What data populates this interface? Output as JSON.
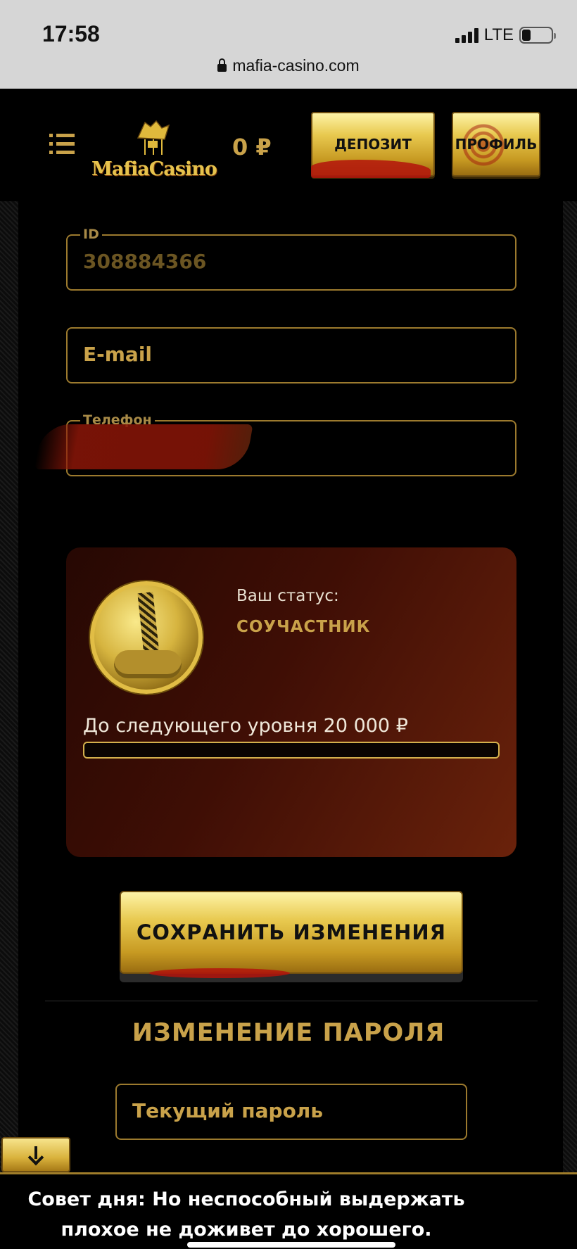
{
  "status_bar": {
    "time": "17:58",
    "network": "LTE",
    "url": "mafia-casino.com"
  },
  "header": {
    "logo_text": "MafiaCasino",
    "balance": "0 ₽",
    "deposit_label": "ДЕПОЗИТ",
    "profile_label": "ПРОФИЛЬ"
  },
  "form": {
    "id_label": "ID",
    "id_value": "308884366",
    "email_placeholder": "E-mail",
    "phone_label": "Телефон"
  },
  "status_card": {
    "label": "Ваш статус:",
    "value": "СОУЧАСТНИК",
    "next_level": "До следующего уровня 20 000 ₽",
    "progress": 0
  },
  "save_button_label": "СОХРАНИТЬ ИЗМЕНЕНИЯ",
  "password_section": {
    "title": "ИЗМЕНЕНИЕ ПАРОЛЯ",
    "current_placeholder": "Текущий пароль"
  },
  "tip": "Совет дня: Но неспособный выдержать плохое не доживет до хорошего.",
  "icons": {
    "menu": "menu-icon",
    "lock": "lock-icon",
    "scroll": "arrow-down-icon"
  },
  "colors": {
    "accent": "#c9a24a",
    "card": "#4a1206"
  }
}
